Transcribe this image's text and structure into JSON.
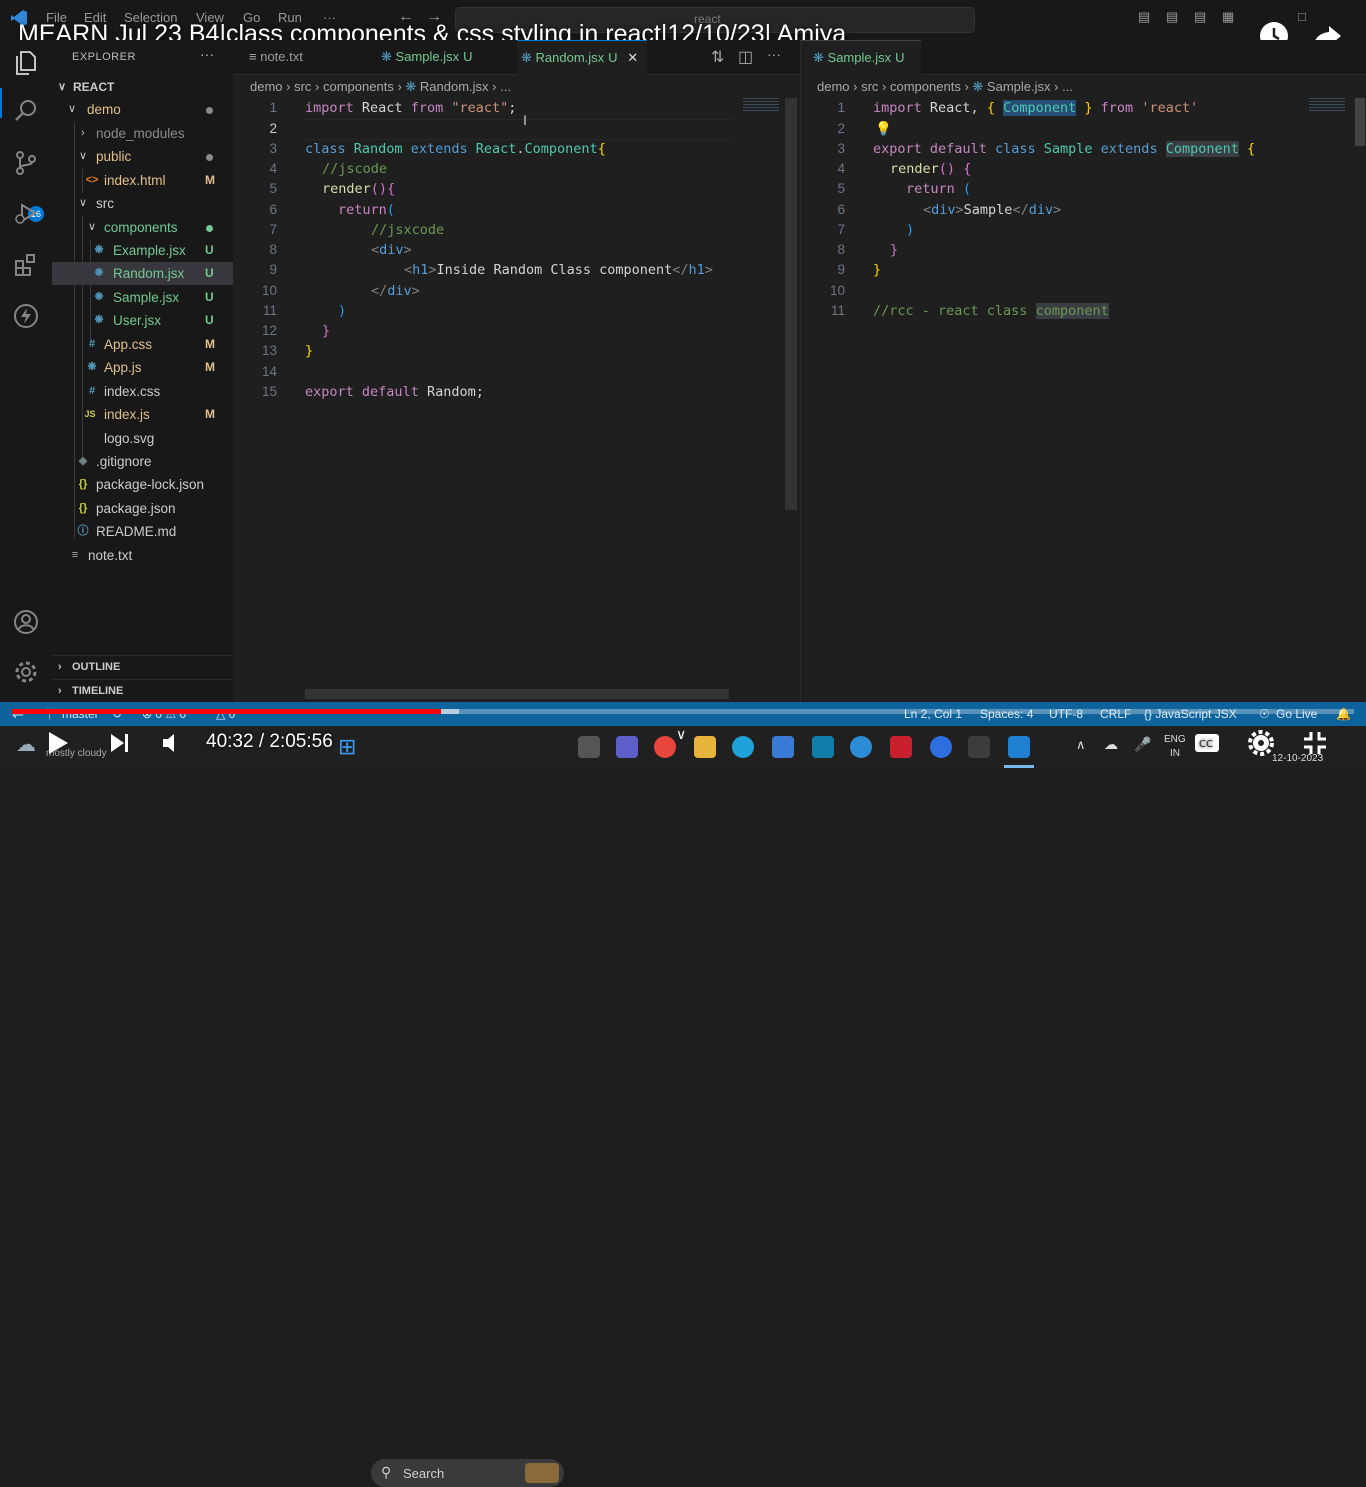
{
  "video": {
    "title": "MEARN Jul 23 B4|class components & css styling in react|12/10/23| Amiya",
    "time": "40:32 / 2:05:56",
    "progress_fraction": 0.32
  },
  "titlebar": {
    "menu": [
      "File",
      "Edit",
      "Selection",
      "View",
      "Go",
      "Run",
      "···"
    ],
    "search": "react"
  },
  "activity_badge": "16",
  "sidebar": {
    "header": "EXPLORER",
    "root": "REACT",
    "items": [
      {
        "label": "demo",
        "status": "",
        "dot": true
      },
      {
        "label": "node_modules",
        "status": "",
        "dot": false
      },
      {
        "label": "public",
        "status": "",
        "dot": true
      },
      {
        "label": "index.html",
        "status": "M",
        "dot": false
      },
      {
        "label": "src",
        "status": "",
        "dot": false
      },
      {
        "label": "components",
        "status": "",
        "dot": true
      },
      {
        "label": "Example.jsx",
        "status": "U",
        "dot": false
      },
      {
        "label": "Random.jsx",
        "status": "U",
        "dot": false
      },
      {
        "label": "Sample.jsx",
        "status": "U",
        "dot": false
      },
      {
        "label": "User.jsx",
        "status": "U",
        "dot": false
      },
      {
        "label": "App.css",
        "status": "M",
        "dot": false
      },
      {
        "label": "App.js",
        "status": "M",
        "dot": false
      },
      {
        "label": "index.css",
        "status": "",
        "dot": false
      },
      {
        "label": "index.js",
        "status": "M",
        "dot": false
      },
      {
        "label": "logo.svg",
        "status": "",
        "dot": false
      },
      {
        "label": ".gitignore",
        "status": "",
        "dot": false
      },
      {
        "label": "package-lock.json",
        "status": "",
        "dot": false
      },
      {
        "label": "package.json",
        "status": "",
        "dot": false
      },
      {
        "label": "README.md",
        "status": "",
        "dot": false
      },
      {
        "label": "note.txt",
        "status": "",
        "dot": false
      }
    ],
    "outline": "OUTLINE",
    "timeline": "TIMELINE"
  },
  "editor_left": {
    "tabs": [
      {
        "label": "note.txt",
        "status": ""
      },
      {
        "label": "Sample.jsx",
        "status": "U"
      },
      {
        "label": "Random.jsx",
        "status": "U"
      }
    ],
    "breadcrumb": [
      "demo",
      "src",
      "components",
      "Random.jsx",
      "..."
    ],
    "line_numbers": [
      "1",
      "2",
      "3",
      "4",
      "5",
      "6",
      "7",
      "8",
      "9",
      "10",
      "11",
      "12",
      "13",
      "14",
      "15"
    ]
  },
  "editor_right": {
    "tab": {
      "label": "Sample.jsx",
      "status": "U"
    },
    "breadcrumb": [
      "demo",
      "src",
      "components",
      "Sample.jsx",
      "..."
    ],
    "line_numbers": [
      "1",
      "2",
      "3",
      "4",
      "5",
      "6",
      "7",
      "8",
      "9",
      "10",
      "11"
    ]
  },
  "statusbar": {
    "branch": "master",
    "problems": "⊗ 0 ⚠ 0",
    "ports": "△ 0",
    "position": "Ln 2, Col 1",
    "spaces": "Spaces: 4",
    "encoding": "UTF-8",
    "eol": "CRLF",
    "language": "{} JavaScript JSX",
    "golive": "Go Live"
  },
  "taskbar": {
    "weather": "mostly cloudy",
    "search": "Search",
    "lang1": "ENG",
    "lang2": "IN",
    "date": "12-10-2023"
  }
}
